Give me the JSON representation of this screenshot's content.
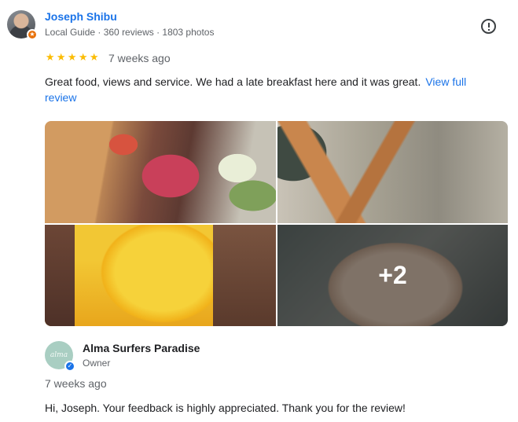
{
  "reviewer": {
    "name": "Joseph Shibu",
    "meta": "Local Guide · 360 reviews · 1803 photos"
  },
  "review": {
    "rating": 5,
    "stars": [
      "★",
      "★",
      "★",
      "★",
      "★"
    ],
    "time": "7 weeks ago",
    "text": "Great food, views and service. We had a late breakfast here and it was great.",
    "view_full": "View full review"
  },
  "photos": {
    "more_count": "+2"
  },
  "owner_reply": {
    "logo_text": "alma",
    "name": "Alma Surfers Paradise",
    "role": "Owner",
    "time": "7 weeks ago",
    "text": "Hi, Joseph. Your feedback is highly appreciated. Thank you for the review!"
  },
  "colors": {
    "link": "#1a73e8",
    "star": "#fbbc04",
    "local_guide_badge": "#e8710a",
    "owner_logo_bg": "#a9cec2"
  },
  "icons": {
    "report": "report-icon",
    "local_guide": "local-guide-badge-icon",
    "verified": "verified-check-icon"
  }
}
